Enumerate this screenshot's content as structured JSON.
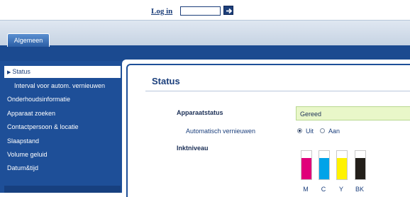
{
  "login": {
    "label": "Log in",
    "input_value": ""
  },
  "tabs": [
    {
      "label": "Algemeen",
      "active": true
    }
  ],
  "sidebar": {
    "items": [
      {
        "label": "Status",
        "active": true
      },
      {
        "label": "Interval voor autom. vernieuwen",
        "sub": true
      },
      {
        "label": "Onderhoudsinformatie"
      },
      {
        "label": "Apparaat zoeken"
      },
      {
        "label": "Contactpersoon & locatie"
      },
      {
        "label": "Slaapstand"
      },
      {
        "label": "Volume geluid"
      },
      {
        "label": "Datum&tijd"
      }
    ]
  },
  "main": {
    "title": "Status",
    "device_status_label": "Apparaatstatus",
    "device_status_value": "Gereed",
    "auto_refresh_label": "Automatisch vernieuwen",
    "auto_refresh_options": [
      {
        "label": "Uit",
        "checked": true
      },
      {
        "label": "Aan",
        "checked": false
      }
    ],
    "ink_level_label": "Inktniveau",
    "inks": [
      {
        "label": "M",
        "color": "#e0007a",
        "level": 0.75
      },
      {
        "label": "C",
        "color": "#00a3e8",
        "level": 0.75
      },
      {
        "label": "Y",
        "color": "#fff200",
        "level": 0.75
      },
      {
        "label": "BK",
        "color": "#231f1a",
        "level": 0.75
      }
    ]
  },
  "colors": {
    "primary_blue": "#1e4f98",
    "status_ok_bg": "#e9f7c9"
  }
}
